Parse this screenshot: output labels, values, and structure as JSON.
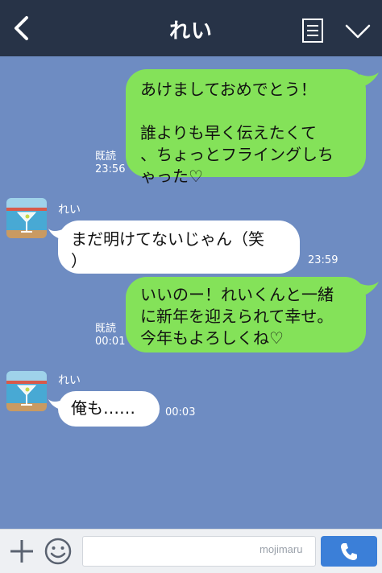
{
  "header": {
    "title": "れい",
    "back_icon": "chevron-left-icon",
    "menu_icon": "list-icon",
    "expand_icon": "chevron-down-icon"
  },
  "messages": [
    {
      "from": "me",
      "text": "あけましておめでとう！\n\n誰よりも早く伝えたくて\n、ちょっとフライングしち\nゃった♡",
      "read": "既読",
      "time": "23:56"
    },
    {
      "from": "them",
      "sender": "れい",
      "text": "まだ明けてないじゃん（笑\n）",
      "time": "23:59"
    },
    {
      "from": "me",
      "text": "いいのー！れいくんと一緒\nに新年を迎えられて幸せ。\n今年もよろしくね♡",
      "read": "既読",
      "time": "00:01"
    },
    {
      "from": "them",
      "sender": "れい",
      "text": "俺も……",
      "time": "00:03"
    }
  ],
  "composer": {
    "input_value": "",
    "watermark": "mojimaru",
    "plus_icon": "plus-icon",
    "emoji_icon": "smiley-icon",
    "call_icon": "phone-icon"
  },
  "colors": {
    "header_bg": "#273347",
    "chat_bg": "#6e8cc2",
    "my_bubble": "#84e259",
    "their_bubble": "#ffffff",
    "call_button": "#3b7fd8"
  }
}
